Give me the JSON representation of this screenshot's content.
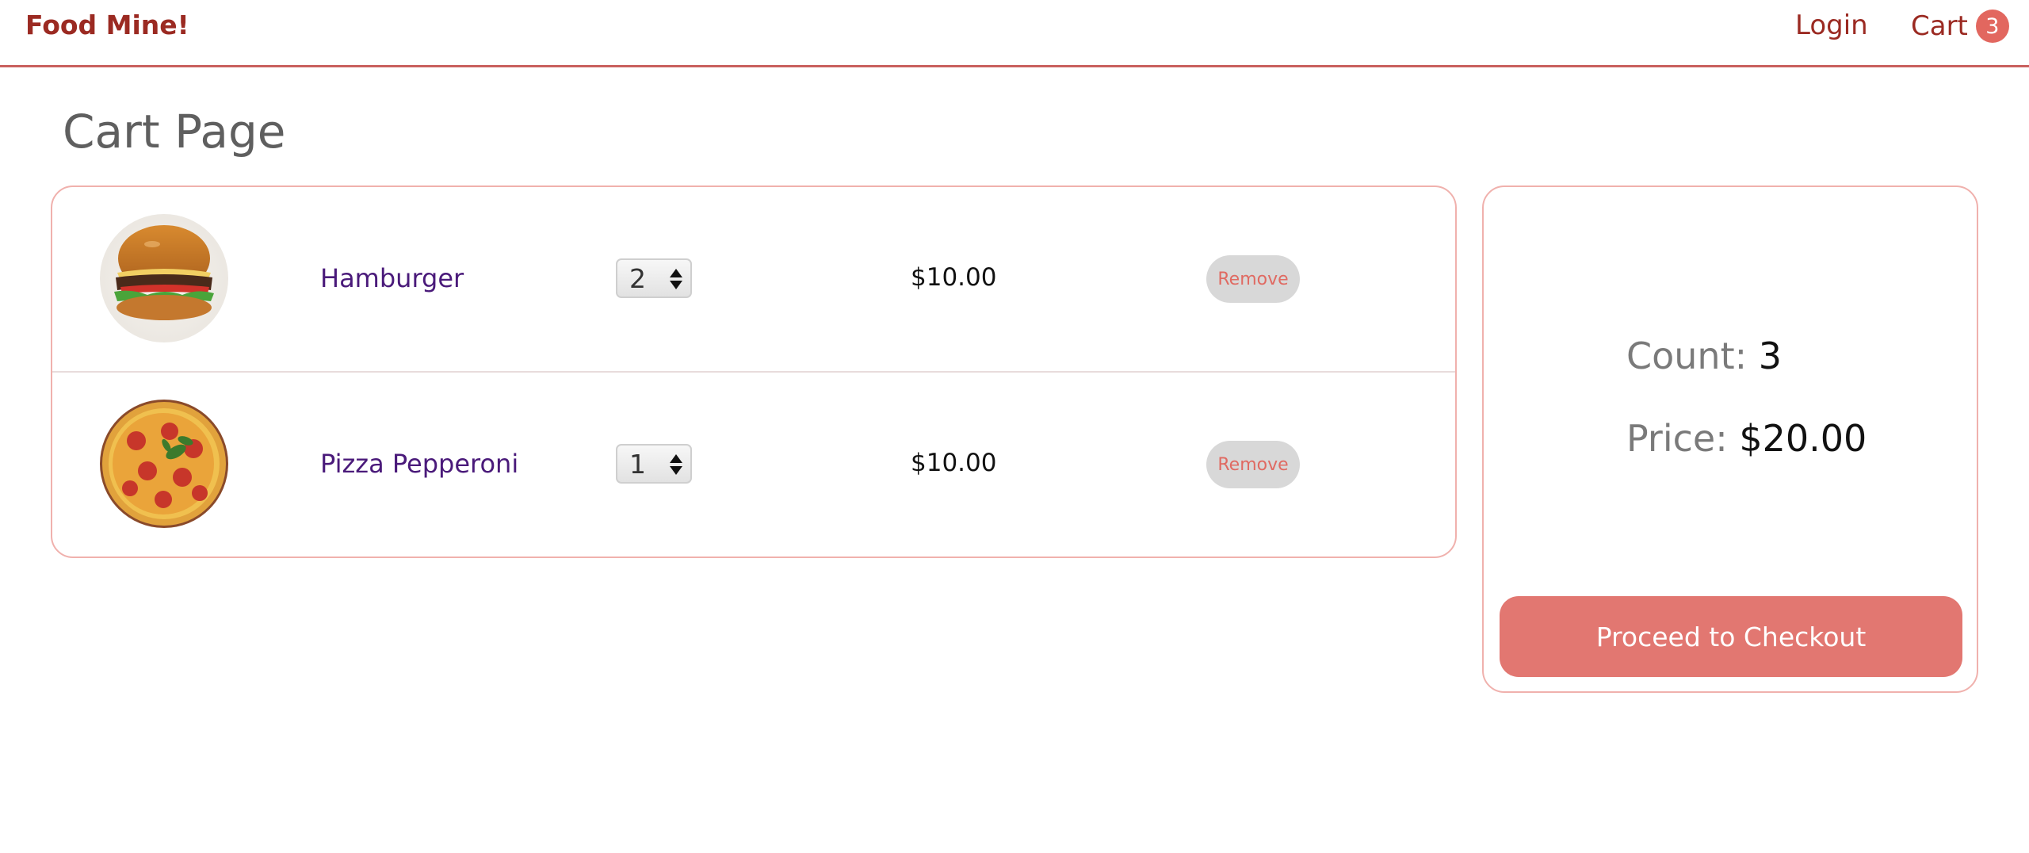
{
  "header": {
    "logo": "Food Mine!",
    "login_label": "Login",
    "cart_label": "Cart",
    "cart_count": "3"
  },
  "page": {
    "title": "Cart Page"
  },
  "cart": {
    "items": [
      {
        "name": "Hamburger",
        "quantity": "2",
        "price": "$10.00",
        "remove_label": "Remove",
        "image_icon": "hamburger-image"
      },
      {
        "name": "Pizza Pepperoni",
        "quantity": "1",
        "price": "$10.00",
        "remove_label": "Remove",
        "image_icon": "pizza-image"
      }
    ]
  },
  "summary": {
    "count_label": "Count:",
    "count_value": "3",
    "price_label": "Price:",
    "price_value": "$20.00",
    "checkout_label": "Proceed to Checkout"
  },
  "colors": {
    "brand": "#9b2a22",
    "accent": "#e27771",
    "border": "#f0b1ad",
    "badge": "#e2675f"
  }
}
